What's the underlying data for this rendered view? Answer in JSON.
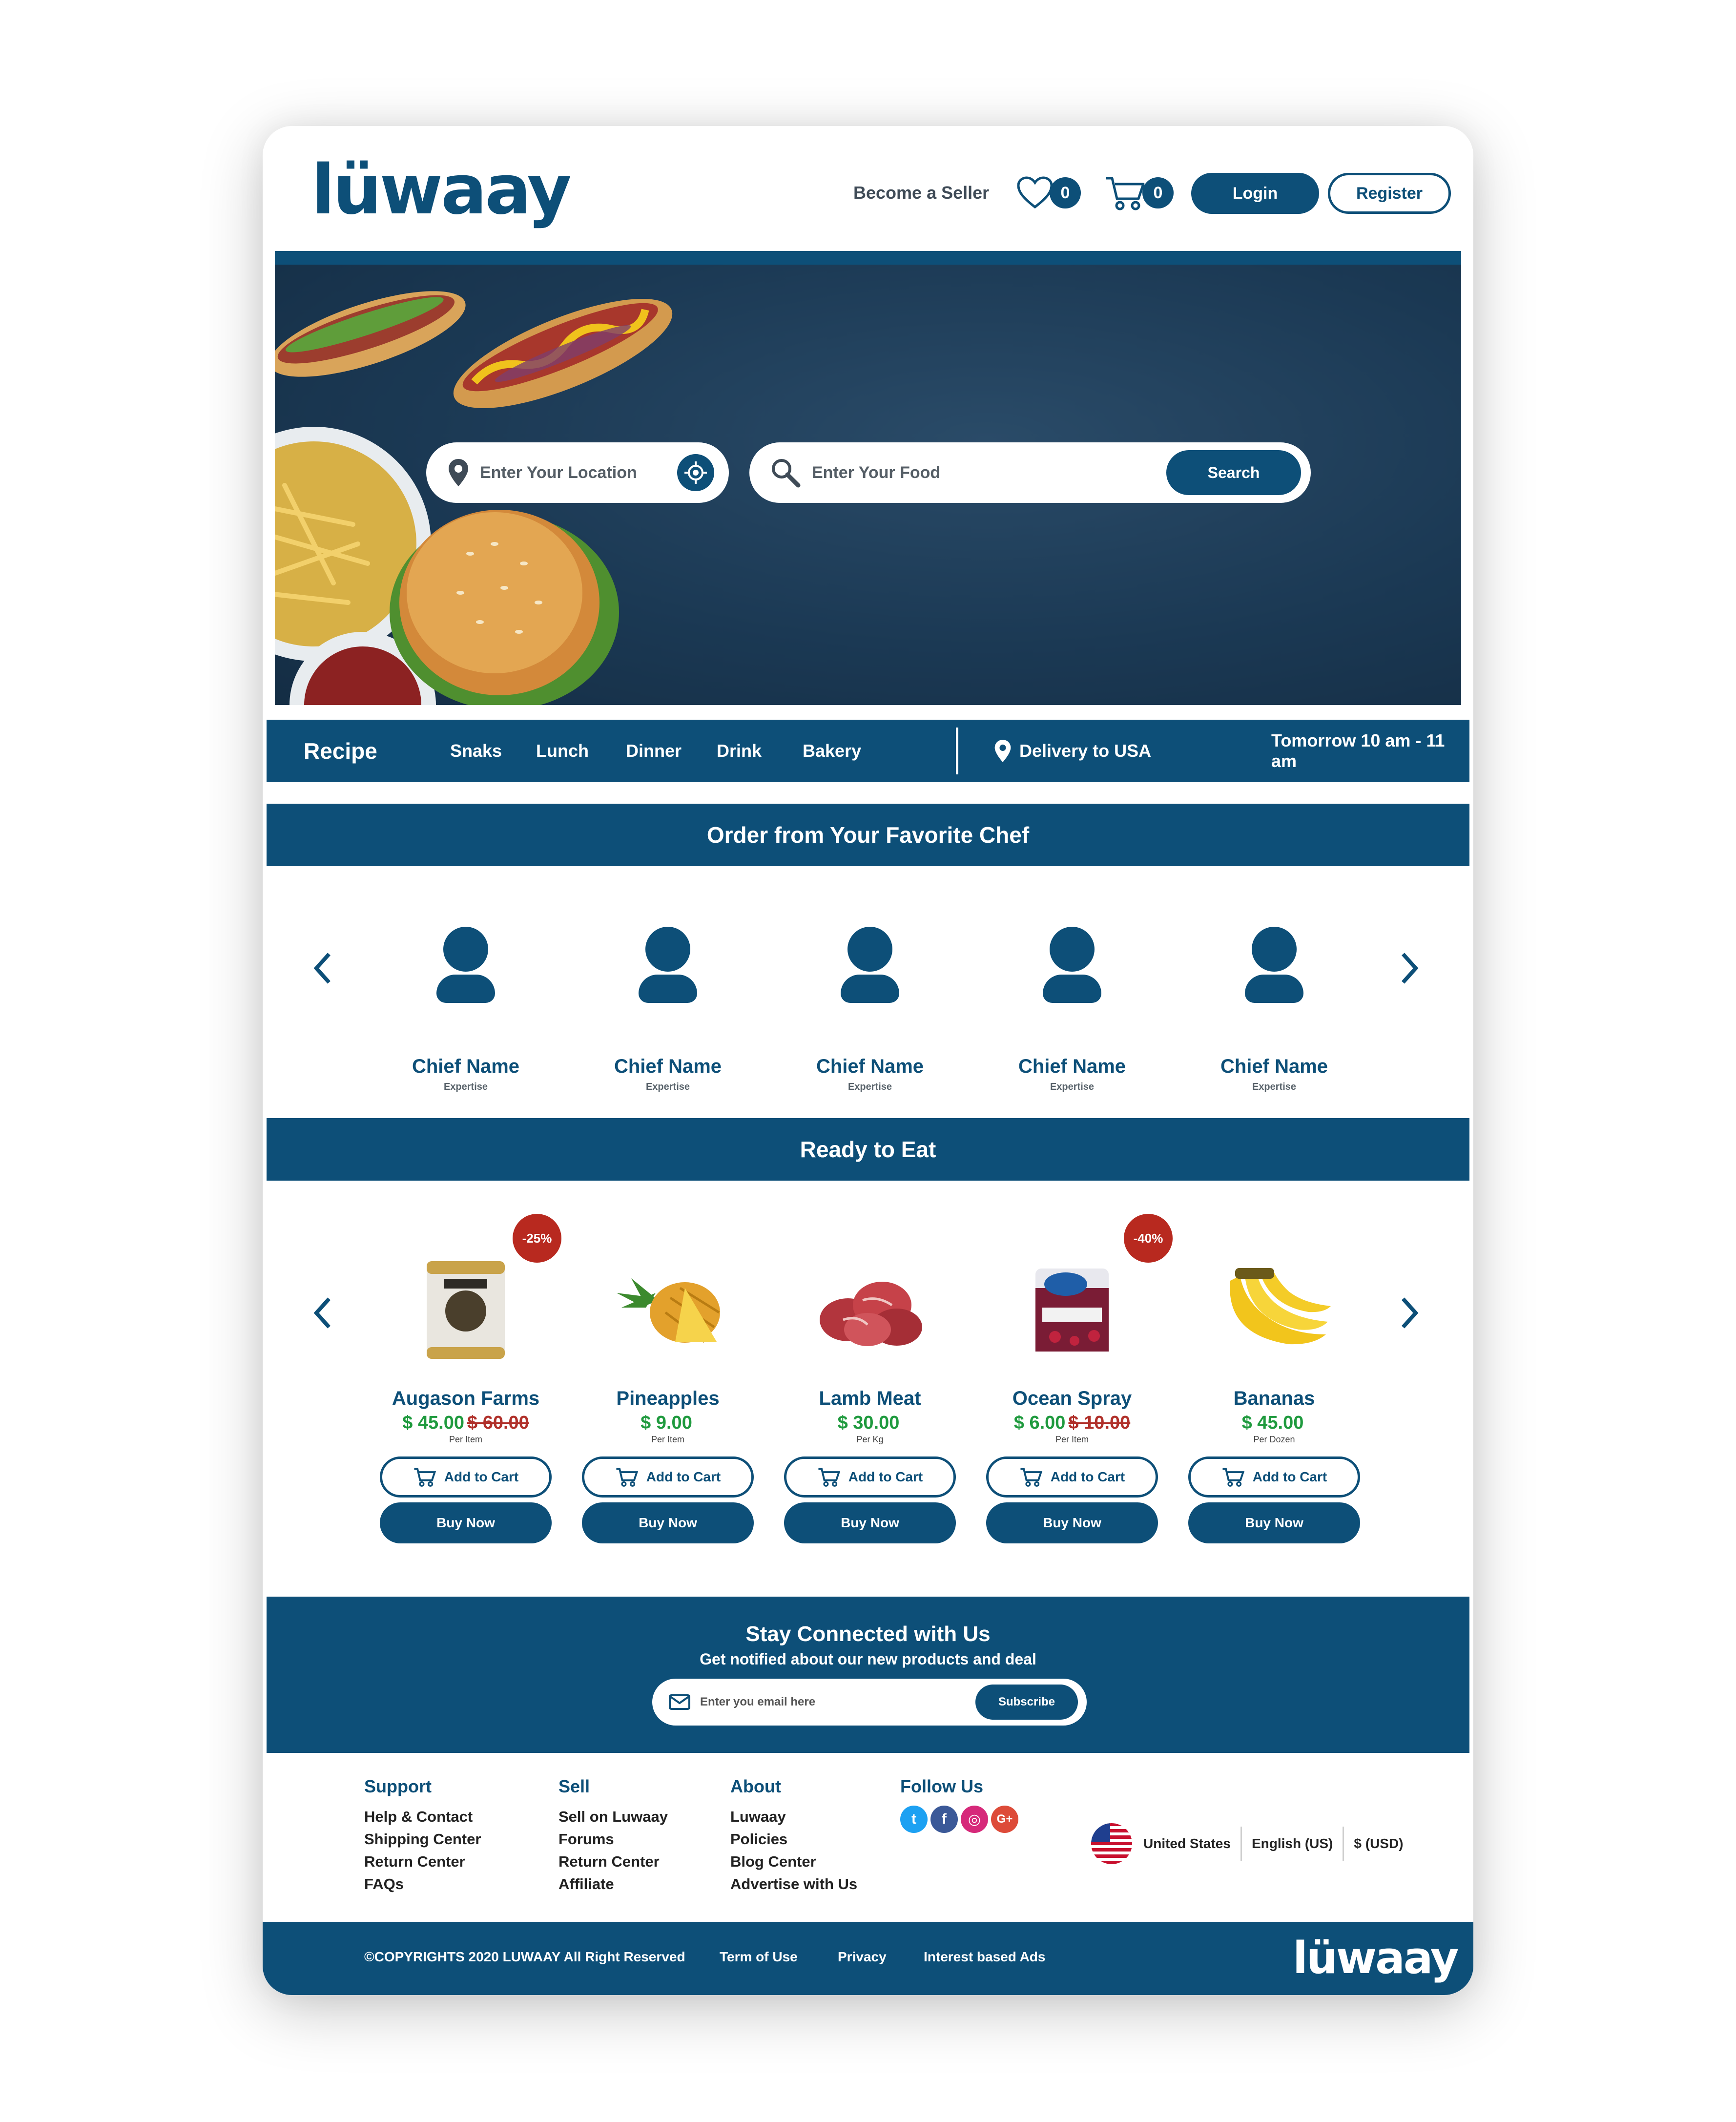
{
  "brand": {
    "logo_text": "lüwaay",
    "primary_color": "#0d4f78",
    "sale_color": "#b8291f",
    "price_color": "#1f9a3e"
  },
  "header": {
    "seller_link": "Become a Seller",
    "wishlist_icon": "heart-icon",
    "wishlist_count": "0",
    "cart_icon": "cart-icon",
    "cart_count": "0",
    "login_label": "Login",
    "register_label": "Register"
  },
  "hero": {
    "location_placeholder": "Enter Your Location",
    "food_placeholder": "Enter Your Food",
    "search_label": "Search"
  },
  "nav": {
    "title": "Recipe",
    "categories": [
      "Snaks",
      "Lunch",
      "Dinner",
      "Drink",
      "Bakery"
    ],
    "delivery": "Delivery to USA",
    "delivery_time": "Tomorrow 10 am - 11 am"
  },
  "chefs_section": {
    "title": "Order from Your Favorite Chef",
    "chefs": [
      {
        "name": "Chief Name",
        "expertise": "Expertise"
      },
      {
        "name": "Chief Name",
        "expertise": "Expertise"
      },
      {
        "name": "Chief Name",
        "expertise": "Expertise"
      },
      {
        "name": "Chief Name",
        "expertise": "Expertise"
      },
      {
        "name": "Chief Name",
        "expertise": "Expertise"
      }
    ]
  },
  "products_section": {
    "title": "Ready to Eat",
    "add_to_cart_label": "Add to Cart",
    "buy_now_label": "Buy Now",
    "products": [
      {
        "name": "Augason Farms",
        "price": "$ 45.00",
        "old_price": "$ 60.00",
        "unit": "Per Item",
        "discount": "-25%",
        "image": "can-icon"
      },
      {
        "name": "Pineapples",
        "price": "$ 9.00",
        "old_price": "",
        "unit": "Per Item",
        "discount": "",
        "image": "pineapple-icon"
      },
      {
        "name": "Lamb Meat",
        "price": "$ 30.00",
        "old_price": "",
        "unit": "Per Kg",
        "discount": "",
        "image": "meat-icon"
      },
      {
        "name": "Ocean Spray",
        "price": "$ 6.00",
        "old_price": "$ 10.00",
        "unit": "Per Item",
        "discount": "-40%",
        "image": "juice-icon"
      },
      {
        "name": "Bananas",
        "price": "$ 45.00",
        "old_price": "",
        "unit": "Per Dozen",
        "discount": "",
        "image": "banana-icon"
      }
    ]
  },
  "newsletter": {
    "title": "Stay Connected with Us",
    "subtitle": "Get notified about our new products and deal",
    "email_placeholder": "Enter you email here",
    "subscribe_label": "Subscribe"
  },
  "footer": {
    "columns": [
      {
        "title": "Support",
        "links": [
          "Help & Contact",
          "Shipping Center",
          "Return Center",
          "FAQs"
        ]
      },
      {
        "title": "Sell",
        "links": [
          "Sell on Luwaay",
          "Forums",
          "Return Center",
          "Affiliate"
        ]
      },
      {
        "title": "About",
        "links": [
          "Luwaay",
          "Policies",
          "Blog Center",
          "Advertise with Us"
        ]
      }
    ],
    "follow_title": "Follow Us",
    "social": [
      {
        "icon": "twitter-icon",
        "glyph": "t",
        "color": "#1da1f2"
      },
      {
        "icon": "facebook-icon",
        "glyph": "f",
        "color": "#3b5998"
      },
      {
        "icon": "instagram-icon",
        "glyph": "◎",
        "color": "#d6297a"
      },
      {
        "icon": "google-plus-icon",
        "glyph": "G+",
        "color": "#dd4b39"
      }
    ],
    "country": "United States",
    "language": "English (US)",
    "currency": "$ (USD)",
    "copyright": "©COPYRIGHTS 2020 LUWAAY All Right Reserved",
    "bottom_links": [
      "Term of Use",
      "Privacy",
      "Interest based Ads"
    ]
  }
}
